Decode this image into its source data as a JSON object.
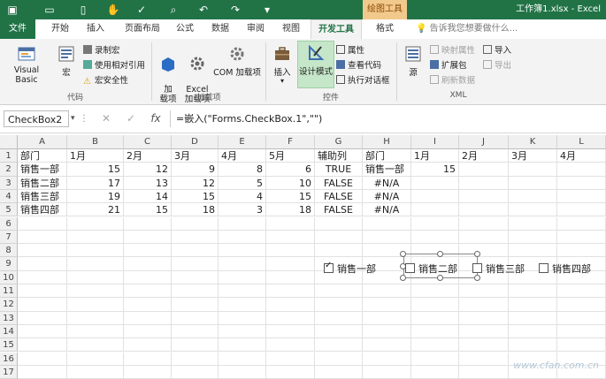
{
  "title_bar": {
    "tool_context": "绘图工具",
    "window_title": "工作簿1.xlsx - Excel"
  },
  "tabs": [
    "文件",
    "开始",
    "插入",
    "页面布局",
    "公式",
    "数据",
    "审阅",
    "视图",
    "开发工具",
    "格式"
  ],
  "tell_me": "告诉我您想要做什么...",
  "ribbon": {
    "code": {
      "label": "代码",
      "visual_basic": "Visual Basic",
      "macros": "宏",
      "record_macro": "录制宏",
      "relative_ref": "使用相对引用",
      "macro_security": "宏安全性"
    },
    "addins": {
      "label": "加载项",
      "addins_btn": "加\n载项",
      "excel_addins": "Excel\n加载项",
      "com_addins": "COM 加载项"
    },
    "controls": {
      "label": "控件",
      "insert": "插入",
      "design_mode": "设计模式",
      "properties": "属性",
      "view_code": "查看代码",
      "run_dialog": "执行对话框"
    },
    "xml": {
      "label": "XML",
      "source": "源",
      "map_properties": "映射属性",
      "expansion_packs": "扩展包",
      "refresh_data": "刷新数据",
      "import": "导入",
      "export": "导出"
    }
  },
  "formula_bar": {
    "name_box": "CheckBox2",
    "fx": "fx",
    "formula": "=嵌入(\"Forms.CheckBox.1\",\"\")"
  },
  "columns": [
    "A",
    "B",
    "C",
    "D",
    "E",
    "F",
    "G",
    "H",
    "I",
    "J",
    "K",
    "L"
  ],
  "rows": [
    "1",
    "2",
    "3",
    "4",
    "5",
    "6",
    "7",
    "8",
    "9",
    "10",
    "11",
    "12",
    "13",
    "14",
    "15",
    "16",
    "17"
  ],
  "cells": [
    [
      "部门",
      "1月",
      "2月",
      "3月",
      "4月",
      "5月",
      "辅助列",
      "部门",
      "1月",
      "2月",
      "3月",
      "4月"
    ],
    [
      "销售一部",
      "15",
      "12",
      "9",
      "8",
      "6",
      "TRUE",
      "销售一部",
      "15",
      "",
      "",
      ""
    ],
    [
      "销售二部",
      "17",
      "13",
      "12",
      "5",
      "10",
      "FALSE",
      "#N/A",
      "",
      "",
      "",
      ""
    ],
    [
      "销售三部",
      "19",
      "14",
      "15",
      "4",
      "15",
      "FALSE",
      "#N/A",
      "",
      "",
      "",
      ""
    ],
    [
      "销售四部",
      "21",
      "15",
      "18",
      "3",
      "18",
      "FALSE",
      "#N/A",
      "",
      "",
      "",
      ""
    ]
  ],
  "checkboxes": [
    {
      "label": "销售一部",
      "checked": true
    },
    {
      "label": "销售二部",
      "checked": false,
      "selected": true
    },
    {
      "label": "销售三部",
      "checked": false
    },
    {
      "label": "销售四部",
      "checked": false
    }
  ],
  "watermark": "www.cfan.com.cn"
}
